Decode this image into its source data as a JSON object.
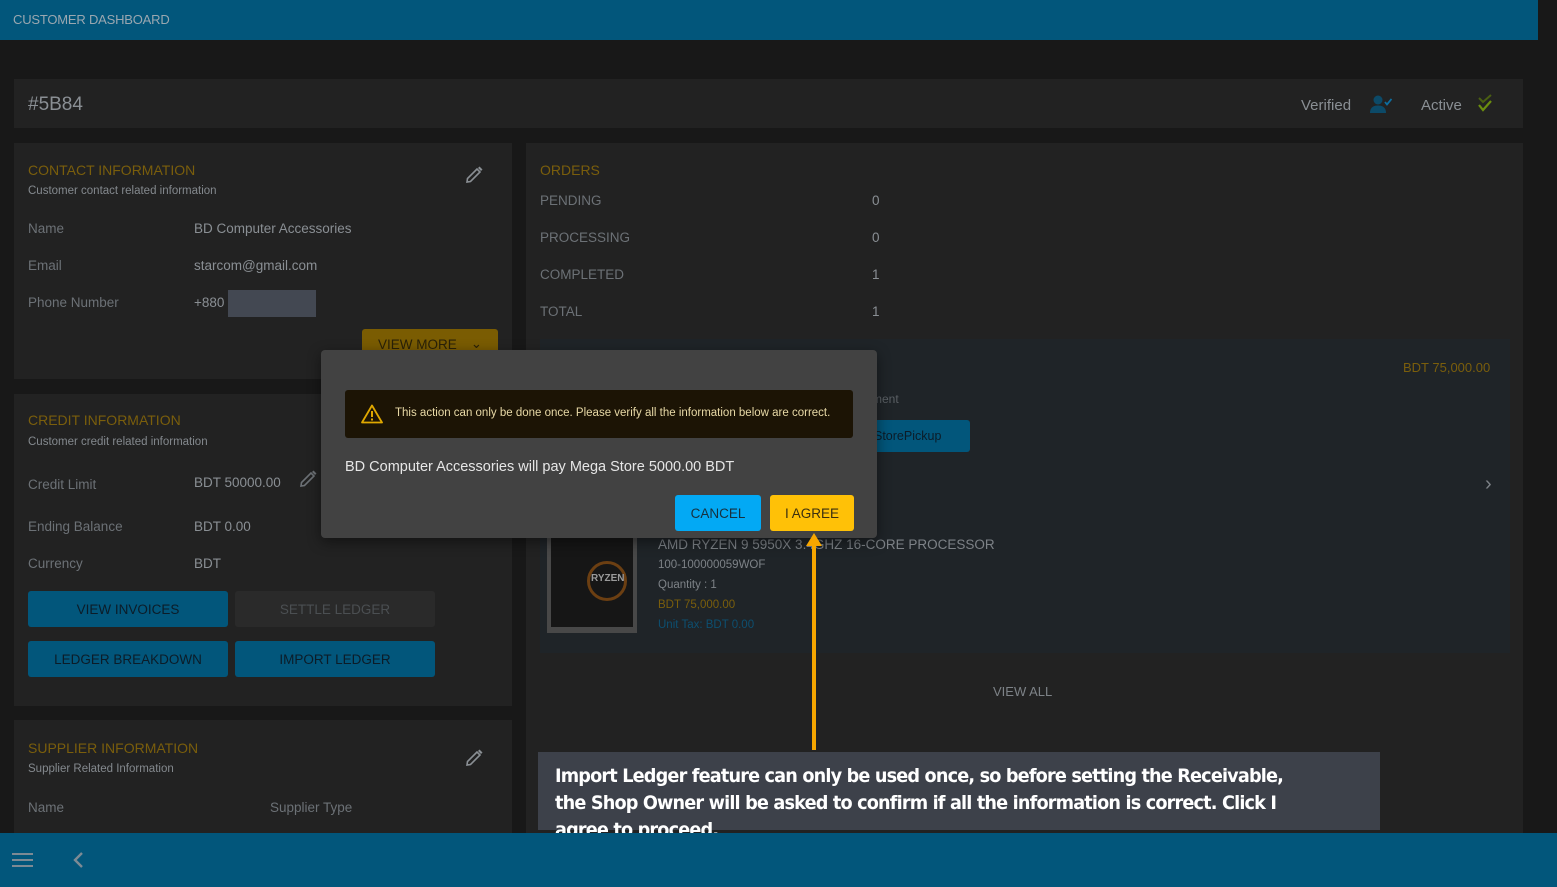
{
  "app": {
    "title": "CUSTOMER DASHBOARD"
  },
  "header": {
    "customer_id": "#5B84",
    "verified_label": "Verified",
    "active_label": "Active",
    "colors": {
      "verified_icon": "#0c4a68",
      "active_icon": "#6b8e0e"
    }
  },
  "contact": {
    "title": "CONTACT INFORMATION",
    "subtitle": "Customer contact related information",
    "fields": [
      {
        "label": "Name",
        "value": "BD Computer Accessories"
      },
      {
        "label": "Email",
        "value": "starcom@gmail.com"
      },
      {
        "label": "Phone Number",
        "value": "+880"
      }
    ],
    "view_more_label": "VIEW MORE"
  },
  "credit": {
    "title": "CREDIT INFORMATION",
    "subtitle": "Customer credit related information",
    "fields": [
      {
        "label": "Credit Limit",
        "value": "BDT 50000.00"
      },
      {
        "label": "Ending Balance",
        "value": "BDT 0.00"
      },
      {
        "label": "Currency",
        "value": "BDT"
      }
    ],
    "buttons": {
      "view_invoices": "VIEW INVOICES",
      "settle_ledger": "SETTLE LEDGER",
      "ledger_breakdown": "LEDGER BREAKDOWN",
      "import_ledger": "IMPORT LEDGER"
    }
  },
  "supplier": {
    "title": "SUPPLIER INFORMATION",
    "subtitle": "Supplier Related Information",
    "columns": [
      "Name",
      "Supplier Type"
    ]
  },
  "orders": {
    "title": "ORDERS",
    "stats": [
      {
        "label": "PENDING",
        "value": "0"
      },
      {
        "label": "PROCESSING",
        "value": "0"
      },
      {
        "label": "COMPLETED",
        "value": "1"
      },
      {
        "label": "TOTAL",
        "value": "1"
      }
    ],
    "latest": {
      "total": "BDT 75,000.00",
      "payment_label_partial": "ment",
      "delivery_method": "StorePickup",
      "product": {
        "name": "AMD RYZEN 9 5950X 3.4GHZ 16-CORE PROCESSOR",
        "sku": "100-100000059WOF",
        "quantity": "Quantity : 1",
        "price": "BDT 75,000.00",
        "unit_tax": "Unit Tax: BDT 0.00",
        "image_text": "RYZEN"
      }
    },
    "view_all_label": "VIEW ALL"
  },
  "modal": {
    "warning": "This action can only be done once. Please verify all the information below are correct.",
    "message": "BD Computer Accessories will pay Mega Store 5000.00 BDT",
    "cancel_label": "CANCEL",
    "agree_label": "I AGREE",
    "colors": {
      "cancel": "#03a9f4",
      "agree": "#ffc107"
    }
  },
  "annotation": {
    "text": "Import Ledger feature can only be used once, so before setting the Receivable, the Shop Owner will be asked to confirm if all the information is correct. Click I agree to proceed.",
    "arrow_color": "#f7a600"
  },
  "theme": {
    "primary": "#02567b",
    "accent": "#7a5e0c",
    "background": "#181818",
    "card": "#222222"
  }
}
